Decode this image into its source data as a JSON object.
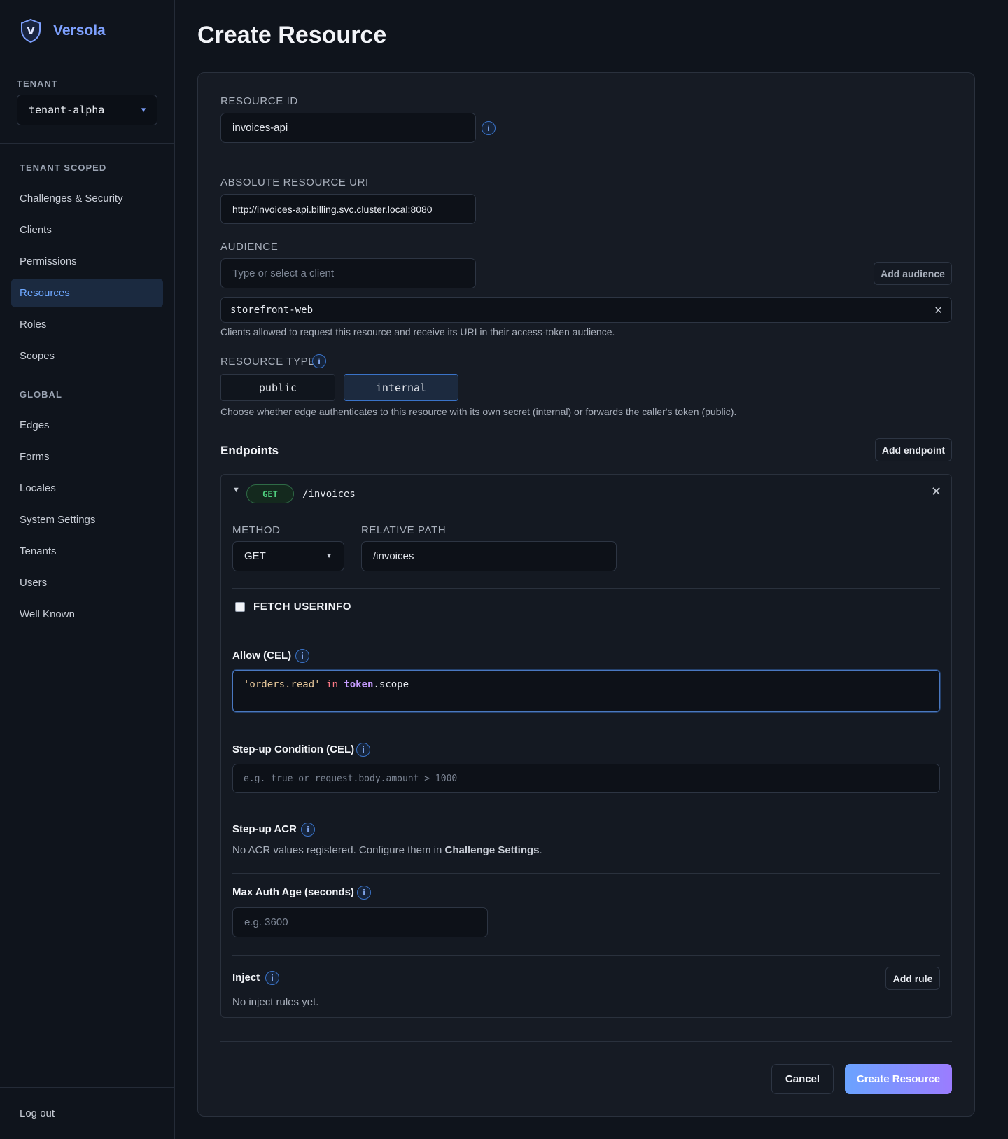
{
  "brand": {
    "name": "Versola",
    "logo_letter": "V"
  },
  "sidebar": {
    "tenant_label": "TENANT",
    "tenant_value": "tenant-alpha",
    "tenant_scoped_label": "TENANT SCOPED",
    "tenant_items": [
      {
        "label": "Challenges & Security"
      },
      {
        "label": "Clients"
      },
      {
        "label": "Permissions"
      },
      {
        "label": "Resources",
        "active": true
      },
      {
        "label": "Roles"
      },
      {
        "label": "Scopes"
      }
    ],
    "global_label": "GLOBAL",
    "global_items": [
      {
        "label": "Edges"
      },
      {
        "label": "Forms"
      },
      {
        "label": "Locales"
      },
      {
        "label": "System Settings"
      },
      {
        "label": "Tenants"
      },
      {
        "label": "Users"
      },
      {
        "label": "Well Known"
      }
    ],
    "logout_label": "Log out"
  },
  "page": {
    "title": "Create Resource"
  },
  "form": {
    "resource_id": {
      "label": "RESOURCE ID",
      "value": "invoices-api"
    },
    "absolute_uri": {
      "label": "ABSOLUTE RESOURCE URI",
      "value": "http://invoices-api.billing.svc.cluster.local:8080"
    },
    "audience": {
      "label": "AUDIENCE",
      "placeholder": "Type or select a client",
      "add_button": "Add audience",
      "chips": [
        "storefront-web"
      ],
      "help": "Clients allowed to request this resource and receive its URI in their access-token audience."
    },
    "resource_type": {
      "label": "RESOURCE TYPE",
      "options": [
        "public",
        "internal"
      ],
      "selected": "internal",
      "help": "Choose whether edge authenticates to this resource with its own secret (internal) or forwards the caller's token (public)."
    },
    "endpoints": {
      "title": "Endpoints",
      "add_button": "Add endpoint",
      "items": [
        {
          "method_badge": "GET",
          "path": "/invoices",
          "method_label": "METHOD",
          "method_value": "GET",
          "relative_path_label": "RELATIVE PATH",
          "relative_path_value": "/invoices",
          "fetch_userinfo_label": "FETCH USERINFO",
          "fetch_userinfo_checked": false,
          "allow_label": "Allow (CEL)",
          "allow_code": {
            "str": "'orders.read'",
            "kw": "in",
            "id": "token",
            "rest": ".scope"
          },
          "stepup_condition_label": "Step-up Condition (CEL)",
          "stepup_condition_placeholder": "e.g. true or request.body.amount > 1000",
          "stepup_acr_label": "Step-up ACR",
          "stepup_acr_text": "No ACR values registered. Configure them in ",
          "stepup_acr_link": "Challenge Settings",
          "stepup_acr_end": ".",
          "max_auth_age_label": "Max Auth Age (seconds)",
          "max_auth_age_placeholder": "e.g. 3600",
          "inject_label": "Inject",
          "inject_add": "Add rule",
          "inject_empty": "No inject rules yet."
        }
      ]
    },
    "cancel_label": "Cancel",
    "submit_label": "Create Resource"
  },
  "info_glyph": "i",
  "close_glyph": "✕",
  "colors": {
    "accent": "#7ea1ff",
    "active_nav": "#6ea8ff",
    "get_badge": "#4fcf7f"
  }
}
